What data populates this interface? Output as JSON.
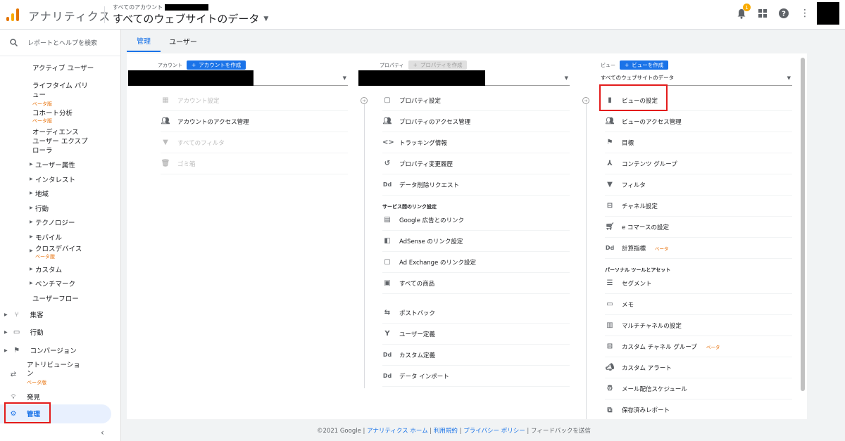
{
  "header": {
    "app_title": "アナリティクス",
    "account_label": "すべてのアカウント",
    "view_title": "すべてのウェブサイトのデータ",
    "notification_count": "1"
  },
  "sidebar": {
    "search_placeholder": "レポートとヘルプを検索",
    "items": [
      {
        "label": "アクティブ ユーザー"
      },
      {
        "label": "ライフタイム バリュー",
        "tag": "ベータ版"
      },
      {
        "label": "コホート分析",
        "tag": "ベータ版"
      },
      {
        "label": "オーディエンス"
      },
      {
        "label": "ユーザー エクスプローラ"
      },
      {
        "label": "ユーザー属性"
      },
      {
        "label": "インタレスト"
      },
      {
        "label": "地域"
      },
      {
        "label": "行動"
      },
      {
        "label": "テクノロジー"
      },
      {
        "label": "モバイル"
      },
      {
        "label": "クロスデバイス",
        "tag": "ベータ版"
      },
      {
        "label": "カスタム"
      },
      {
        "label": "ベンチマーク"
      },
      {
        "label": "ユーザーフロー"
      }
    ],
    "top": [
      {
        "label": "集客"
      },
      {
        "label": "行動"
      },
      {
        "label": "コンバージョン"
      },
      {
        "label": "アトリビューション",
        "tag": "ベータ版"
      },
      {
        "label": "発見"
      },
      {
        "label": "管理"
      }
    ]
  },
  "tabs": [
    {
      "label": "管理"
    },
    {
      "label": "ユーザー"
    }
  ],
  "account_col": {
    "heading": "アカウント",
    "create_label": "アカウントを作成",
    "items": [
      {
        "label": "アカウント設定"
      },
      {
        "label": "アカウントのアクセス管理"
      },
      {
        "label": "すべてのフィルタ"
      },
      {
        "label": "ゴミ箱"
      }
    ]
  },
  "property_col": {
    "heading": "プロパティ",
    "create_label": "プロパティを作成",
    "items": [
      {
        "label": "プロパティ設定"
      },
      {
        "label": "プロパティのアクセス管理"
      },
      {
        "label": "トラッキング情報"
      },
      {
        "label": "プロパティ変更履歴"
      },
      {
        "label": "データ削除リクエスト"
      }
    ],
    "section_label": "サービス間のリンク設定",
    "link_items": [
      {
        "label": "Google 広告とのリンク"
      },
      {
        "label": "AdSense のリンク設定"
      },
      {
        "label": "Ad Exchange のリンク設定"
      },
      {
        "label": "すべての商品"
      },
      {
        "label": "ポストバック"
      },
      {
        "label": "ユーザー定義"
      },
      {
        "label": "カスタム定義"
      },
      {
        "label": "データ インポート"
      }
    ]
  },
  "view_col": {
    "heading": "ビュー",
    "create_label": "ビューを作成",
    "selected_view": "すべてのウェブサイトのデータ",
    "items": [
      {
        "label": "ビューの設定"
      },
      {
        "label": "ビューのアクセス管理"
      },
      {
        "label": "目標"
      },
      {
        "label": "コンテンツ グループ"
      },
      {
        "label": "フィルタ"
      },
      {
        "label": "チャネル設定"
      },
      {
        "label": "e コマースの設定"
      },
      {
        "label": "計算指標",
        "tag": "ベータ"
      }
    ],
    "section_label": "パーソナル ツールとアセット",
    "personal_items": [
      {
        "label": "セグメント"
      },
      {
        "label": "メモ"
      },
      {
        "label": "マルチチャネルの設定"
      },
      {
        "label": "カスタム チャネル グループ",
        "tag": "ベータ"
      },
      {
        "label": "カスタム アラート"
      },
      {
        "label": "メール配信スケジュール"
      },
      {
        "label": "保存済みレポート"
      }
    ]
  },
  "footer": {
    "copyright": "©2021 Google",
    "home": "アナリティクス ホーム",
    "terms": "利用規約",
    "privacy": "プライバシー ポリシー",
    "feedback": "フィードバックを送信"
  },
  "colors": {
    "accent": "#1a73e8",
    "highlight": "#e31b1b",
    "beta": "#e8710a"
  }
}
